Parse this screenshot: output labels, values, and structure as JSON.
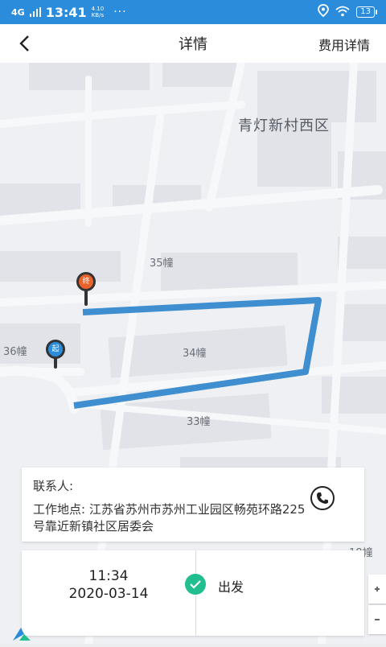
{
  "status_bar": {
    "signal": "4G",
    "time": "13:41",
    "net_speed": "4.10",
    "net_unit": "KB/s",
    "more": "···",
    "battery": "13"
  },
  "header": {
    "title": "详情",
    "fee_link": "费用详情"
  },
  "map": {
    "area_label": "青灯新村西区",
    "buildings": [
      "35幢",
      "34幢",
      "33幢",
      "36幢",
      "18幢"
    ],
    "start_marker": "起",
    "end_marker": "终"
  },
  "info": {
    "contact_label": "联系人:",
    "work_location": "工作地点: 江苏省苏州市苏州工业园区畅苑环路225号靠近新镇社区居委会"
  },
  "timeline": {
    "time": "11:34",
    "date": "2020-03-14",
    "status": "出发"
  },
  "colors": {
    "status_bar": "#2b8cdc",
    "route": "#3f8fd0",
    "check": "#21bf8f"
  }
}
